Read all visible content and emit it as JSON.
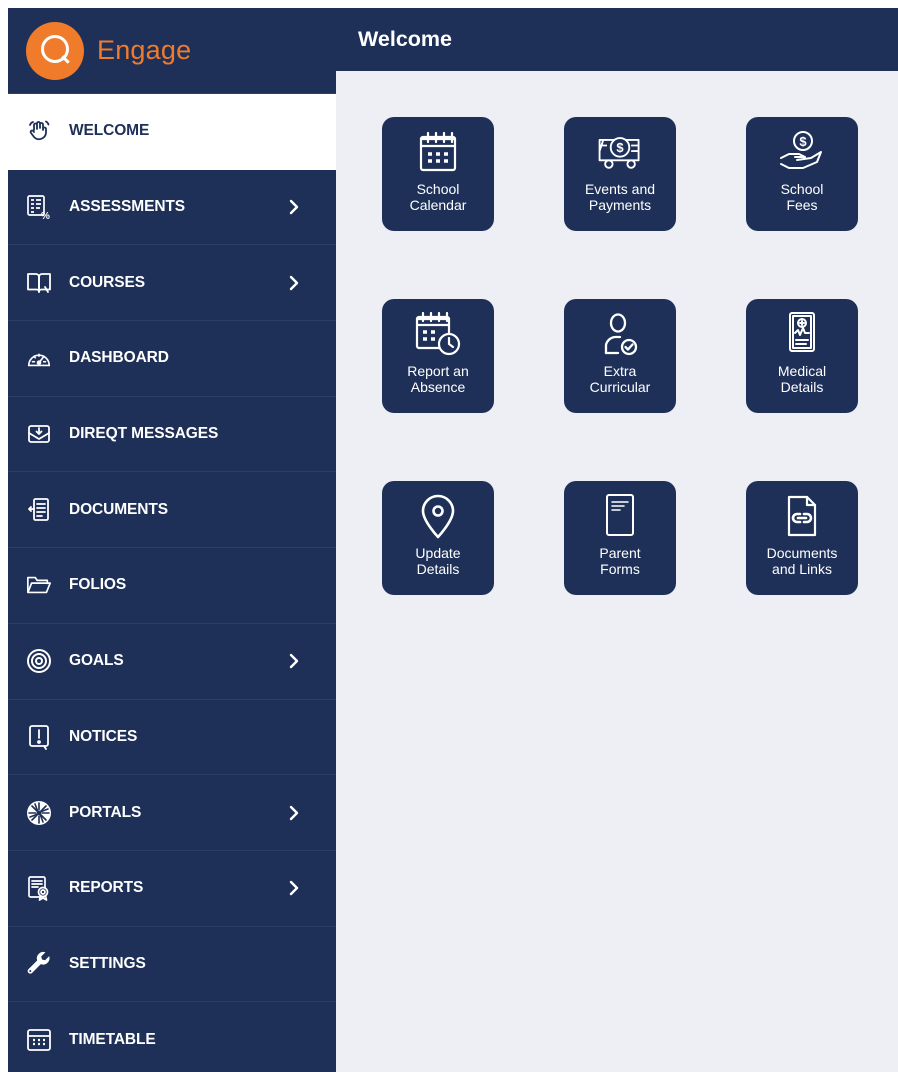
{
  "brand": {
    "name": "Engage",
    "color": "#f07b2a"
  },
  "colors": {
    "navy": "#1e3058",
    "main_bg": "#eeeff5",
    "accent": "#f07b2a"
  },
  "header": {
    "title": "Welcome"
  },
  "sidebar": {
    "items": [
      {
        "label": "WELCOME",
        "icon": "hand-wave-icon",
        "active": true,
        "has_submenu": false
      },
      {
        "label": "ASSESSMENTS",
        "icon": "assessment-grid-percent-icon",
        "active": false,
        "has_submenu": true
      },
      {
        "label": "COURSES",
        "icon": "book-icon",
        "active": false,
        "has_submenu": true
      },
      {
        "label": "DASHBOARD",
        "icon": "speedometer-icon",
        "active": false,
        "has_submenu": false
      },
      {
        "label": "DIREQT MESSAGES",
        "icon": "inbox-icon",
        "active": false,
        "has_submenu": false
      },
      {
        "label": "DOCUMENTS",
        "icon": "document-icon",
        "active": false,
        "has_submenu": false
      },
      {
        "label": "FOLIOS",
        "icon": "folder-icon",
        "active": false,
        "has_submenu": false
      },
      {
        "label": "GOALS",
        "icon": "target-icon",
        "active": false,
        "has_submenu": true
      },
      {
        "label": "NOTICES",
        "icon": "notice-icon",
        "active": false,
        "has_submenu": false
      },
      {
        "label": "PORTALS",
        "icon": "portal-swirl-icon",
        "active": false,
        "has_submenu": true
      },
      {
        "label": "REPORTS",
        "icon": "report-certificate-icon",
        "active": false,
        "has_submenu": true
      },
      {
        "label": "SETTINGS",
        "icon": "wrench-icon",
        "active": false,
        "has_submenu": false
      },
      {
        "label": "TIMETABLE",
        "icon": "timetable-icon",
        "active": false,
        "has_submenu": false
      }
    ]
  },
  "tiles": [
    {
      "label": "School\nCalendar",
      "icon": "calendar-icon"
    },
    {
      "label": "Events and\nPayments",
      "icon": "bus-dollar-icon"
    },
    {
      "label": "School\nFees",
      "icon": "hand-coin-icon"
    },
    {
      "label": "Report an\nAbsence",
      "icon": "calendar-clock-icon"
    },
    {
      "label": "Extra\nCurricular",
      "icon": "person-check-icon"
    },
    {
      "label": "Medical\nDetails",
      "icon": "medical-record-icon"
    },
    {
      "label": "Update\nDetails",
      "icon": "location-pin-icon"
    },
    {
      "label": "Parent\nForms",
      "icon": "form-icon"
    },
    {
      "label": "Documents\nand Links",
      "icon": "link-document-icon"
    }
  ]
}
